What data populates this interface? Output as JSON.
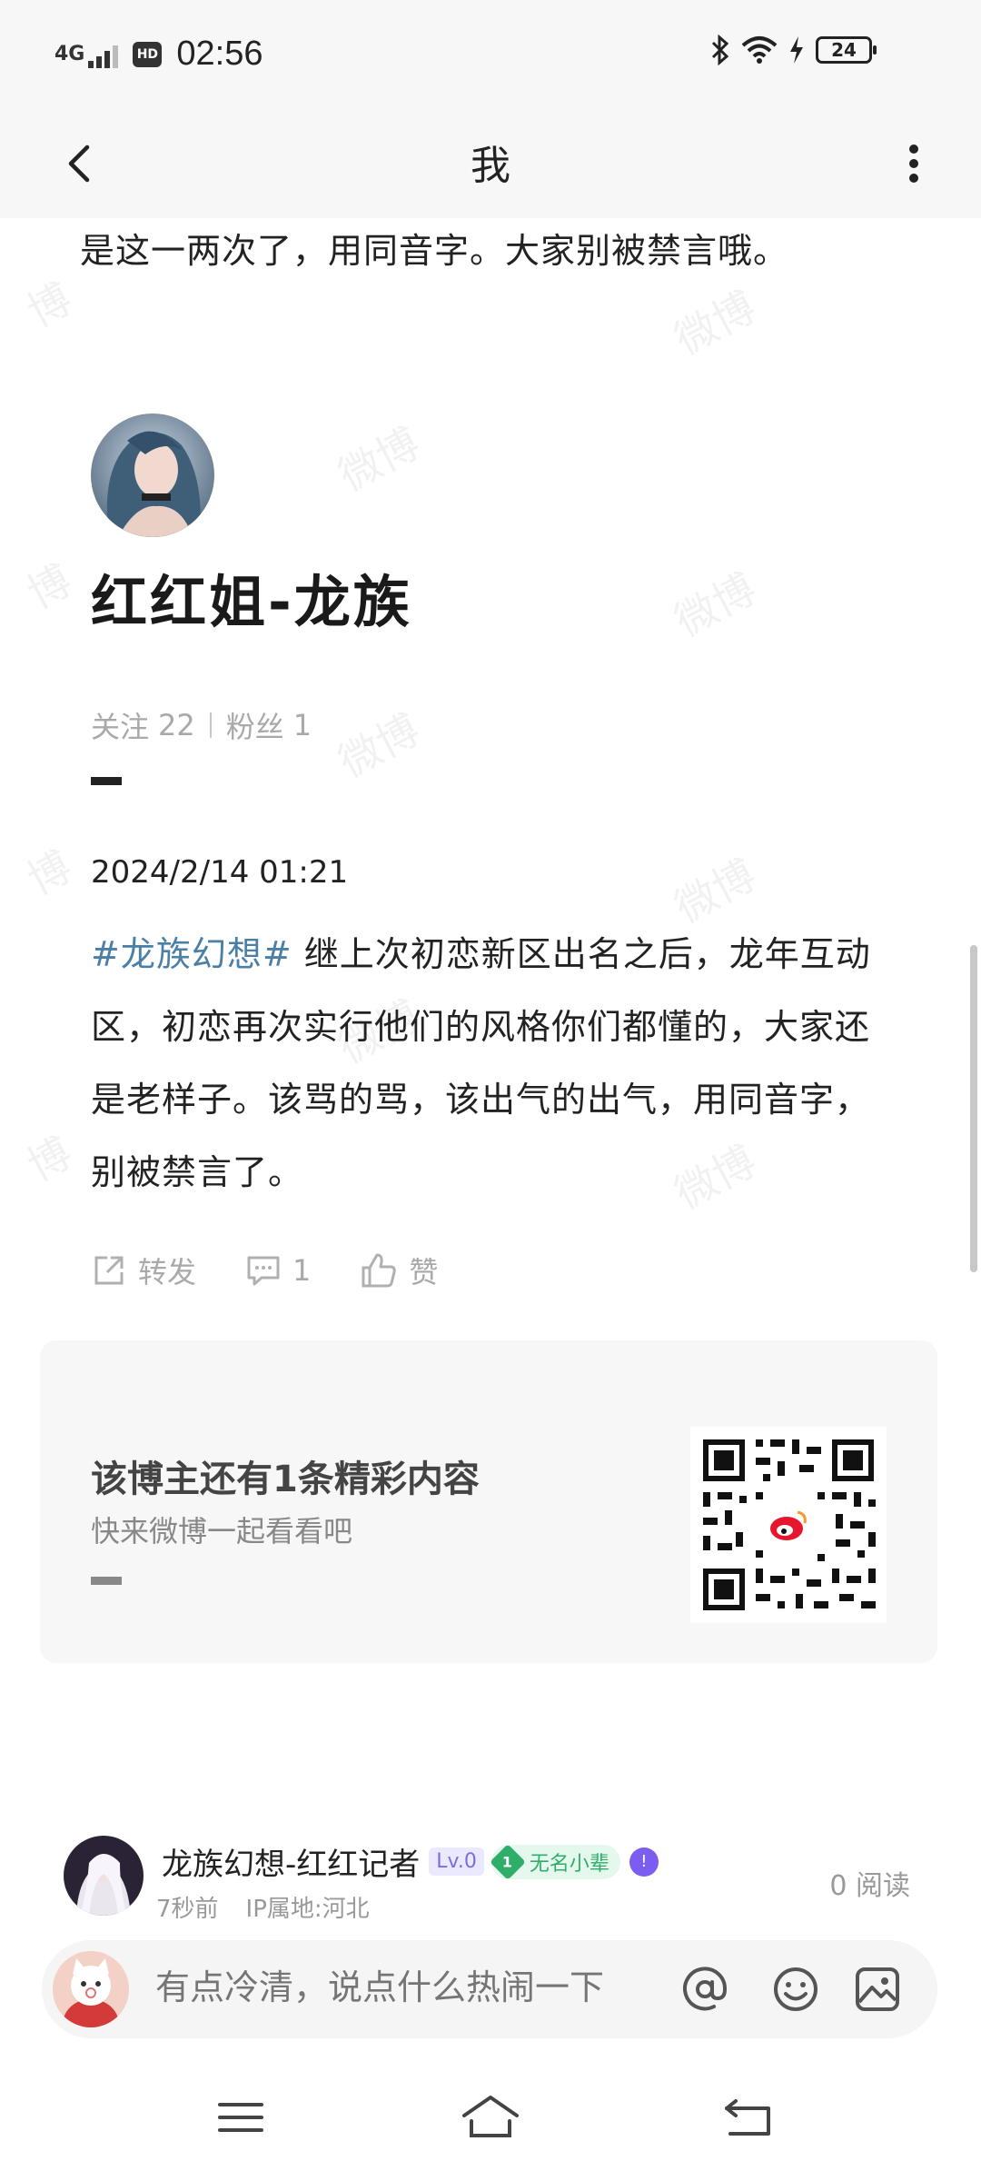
{
  "status_bar": {
    "network": "4G",
    "hd": "HD",
    "time": "02:56",
    "battery": "24"
  },
  "header": {
    "title": "我"
  },
  "post": {
    "previous_line": "是这一两次了，用同音字。大家别被禁言哦。",
    "author": "红红姐-龙族",
    "stats": {
      "following_label": "关注",
      "following": "22",
      "fans_label": "粉丝",
      "fans": "1"
    },
    "date": "2024/2/14 01:21",
    "hashtag": "#龙族幻想#",
    "body": " 继上次初恋新区出名之后，龙年互动区，初恋再次实行他们的风格你们都懂的，大家还是老样子。该骂的骂，该出气的出气，用同音字，别被禁言了。",
    "actions": {
      "repost": "转发",
      "comments": "1",
      "like": "赞"
    }
  },
  "promo": {
    "title": "该博主还有1条精彩内容",
    "subtitle": "快来微博一起看看吧"
  },
  "watermark": {
    "text1": "微博",
    "text2": "博"
  },
  "footer_author": {
    "name": "龙族幻想-红红记者",
    "level": "Lv.0",
    "rank_num": "1",
    "rank": "无名小辈",
    "time": "7秒前",
    "ip": "IP属地:河北",
    "reads": "0 阅读"
  },
  "comment_bar": {
    "placeholder": "有点冷清，说点什么热闹一下"
  },
  "colors": {
    "hashtag": "#4a7fa8",
    "header_bg": "#f7f7f7",
    "card_bg": "#f7f7f7",
    "rank_green": "#2fae6a",
    "level_purple": "#7a6fe0"
  }
}
